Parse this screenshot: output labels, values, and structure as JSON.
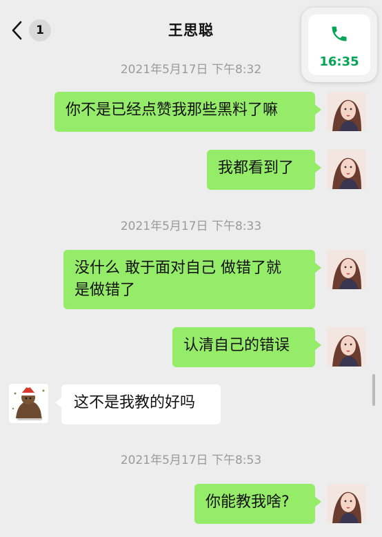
{
  "header": {
    "unread_count": "1",
    "title": "王思聪"
  },
  "call": {
    "time": "16:35",
    "color": "#07a357"
  },
  "timestamps": [
    "2021年5月17日 下午8:32",
    "2021年5月17日 下午8:33",
    "2021年5月17日 下午8:53"
  ],
  "messages": [
    {
      "sender": "me",
      "text": "你不是已经点赞我那些黑料了嘛"
    },
    {
      "sender": "me",
      "text": "我都看到了"
    },
    {
      "sender": "me",
      "line1": "没什么 敢于面对自己 做错了就",
      "line2": "是做错了"
    },
    {
      "sender": "me",
      "text": "认清自己的错误"
    },
    {
      "sender": "other",
      "text": "这不是我教的好吗"
    },
    {
      "sender": "me",
      "text": "你能教我啥?"
    }
  ],
  "colors": {
    "background": "#ededed",
    "my_bubble": "#95ec69",
    "other_bubble": "#ffffff",
    "timestamp": "#9a9a9a"
  },
  "icons": {
    "back": "chevron-left-icon",
    "call": "phone-icon"
  }
}
